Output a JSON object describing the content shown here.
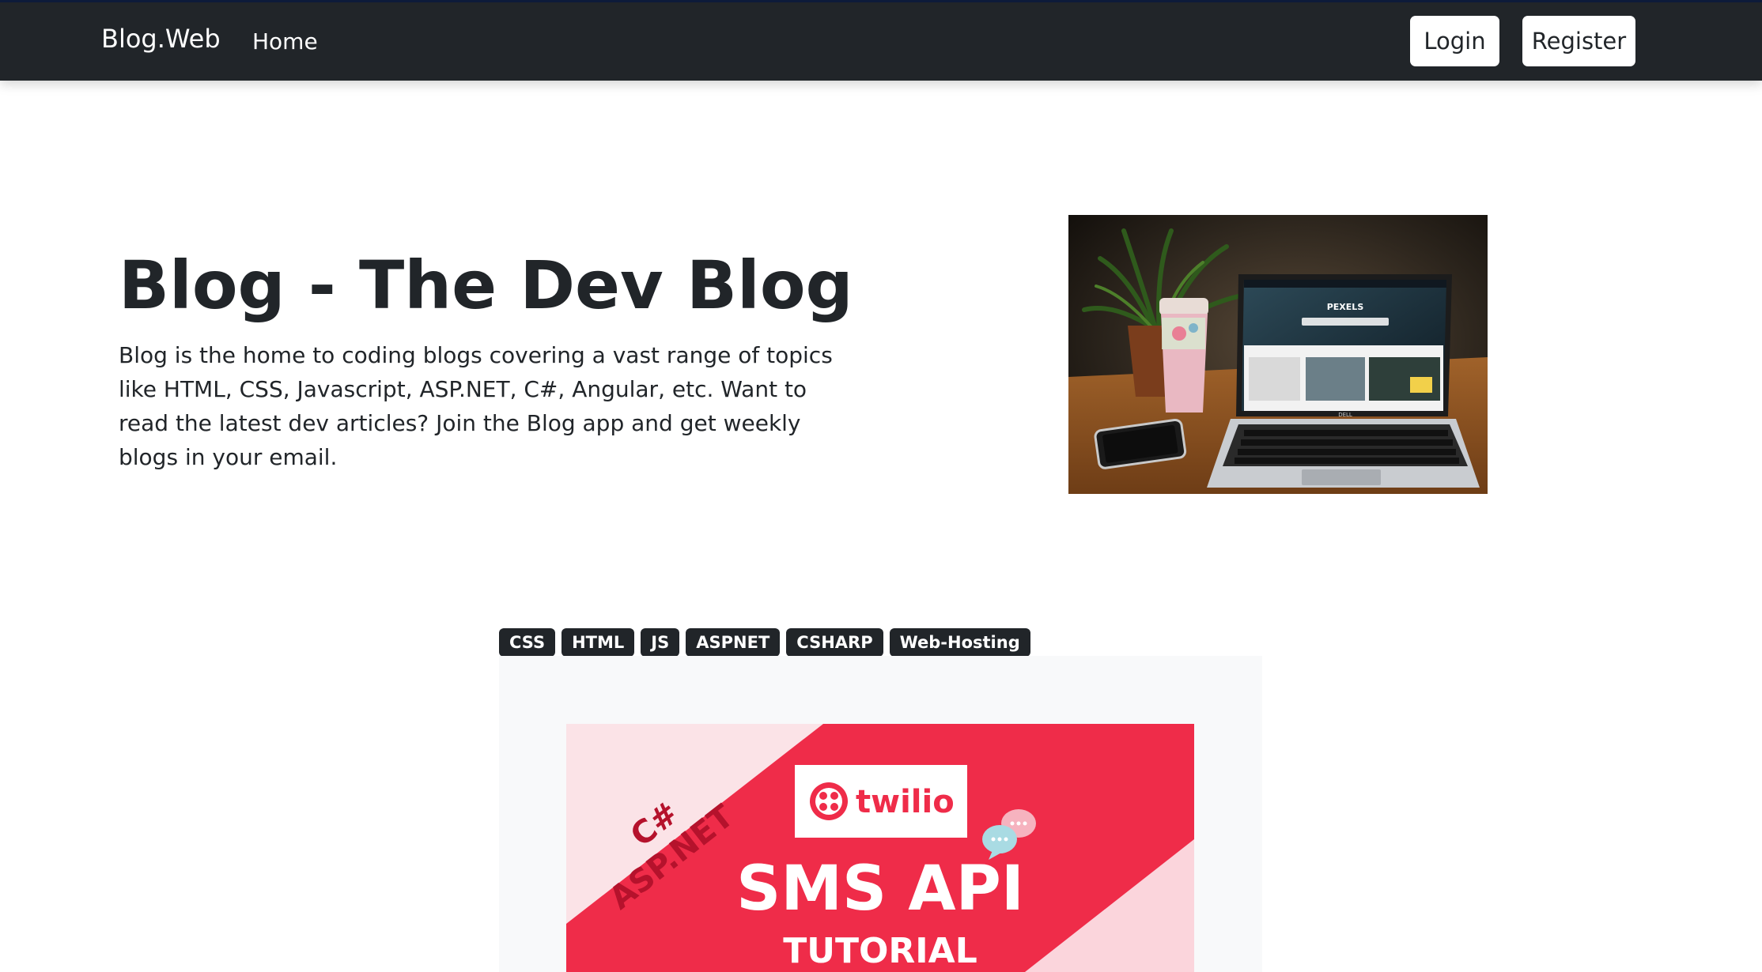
{
  "navbar": {
    "brand": "Blog.Web",
    "home": "Home",
    "login": "Login",
    "register": "Register"
  },
  "hero": {
    "title": "Blog - The Dev Blog",
    "description": "Blog is the home to coding blogs covering a vast range of topics like HTML, CSS, Javascript, ASP.NET, C#, Angular, etc. Want to read the latest dev articles? Join the Blog app and get weekly blogs in your email.",
    "image": {
      "laptop_screen_title": "PEXELS",
      "laptop_brand": "DELL"
    }
  },
  "post": {
    "tags": [
      "CSS",
      "HTML",
      "JS",
      "ASPNET",
      "CSHARP",
      "Web-Hosting"
    ],
    "banner": {
      "corner_line1": "C#",
      "corner_line2": "ASP.NET",
      "logo_text": "twilio",
      "headline": "SMS API",
      "subheadline": "TUTORIAL"
    }
  },
  "colors": {
    "navbar_bg": "#212529",
    "tag_bg": "#212529",
    "banner_red": "#ef2c49",
    "banner_pink": "#fbe3e7",
    "corner_text": "#b5122c"
  }
}
